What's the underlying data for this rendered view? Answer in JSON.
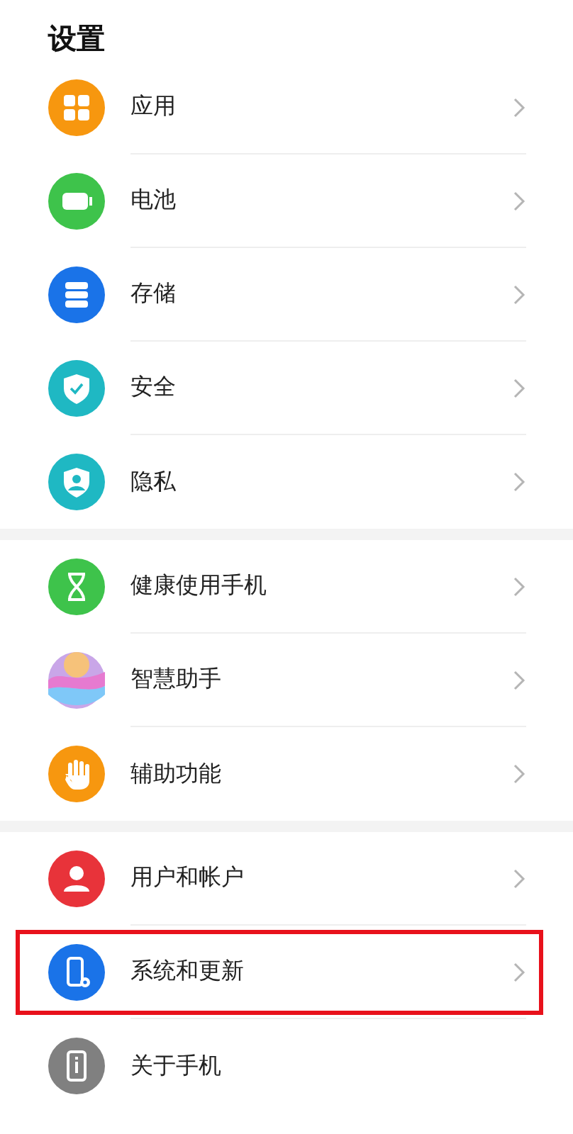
{
  "title": "设置",
  "groups": [
    {
      "items": [
        {
          "label": "应用",
          "color": "#f7970f",
          "chevron": true,
          "highlighted": false
        },
        {
          "label": "电池",
          "color": "#3ec34b",
          "chevron": true,
          "highlighted": false
        },
        {
          "label": "存储",
          "color": "#1a73e8",
          "chevron": true,
          "highlighted": false
        },
        {
          "label": "安全",
          "color": "#1fb8c3",
          "chevron": true,
          "highlighted": false
        },
        {
          "label": "隐私",
          "color": "#1fb8c3",
          "chevron": true,
          "highlighted": false
        }
      ]
    },
    {
      "items": [
        {
          "label": "健康使用手机",
          "color": "#3ec34b",
          "chevron": true,
          "highlighted": false
        },
        {
          "label": "智慧助手",
          "color": "#c9a6e8",
          "chevron": true,
          "highlighted": false
        },
        {
          "label": "辅助功能",
          "color": "#f7970f",
          "chevron": true,
          "highlighted": false
        }
      ]
    },
    {
      "items": [
        {
          "label": "用户和帐户",
          "color": "#e8333a",
          "chevron": true,
          "highlighted": false
        },
        {
          "label": "系统和更新",
          "color": "#1a73e8",
          "chevron": true,
          "highlighted": true
        },
        {
          "label": "关于手机",
          "color": "#808080",
          "chevron": false,
          "highlighted": false
        }
      ]
    }
  ]
}
